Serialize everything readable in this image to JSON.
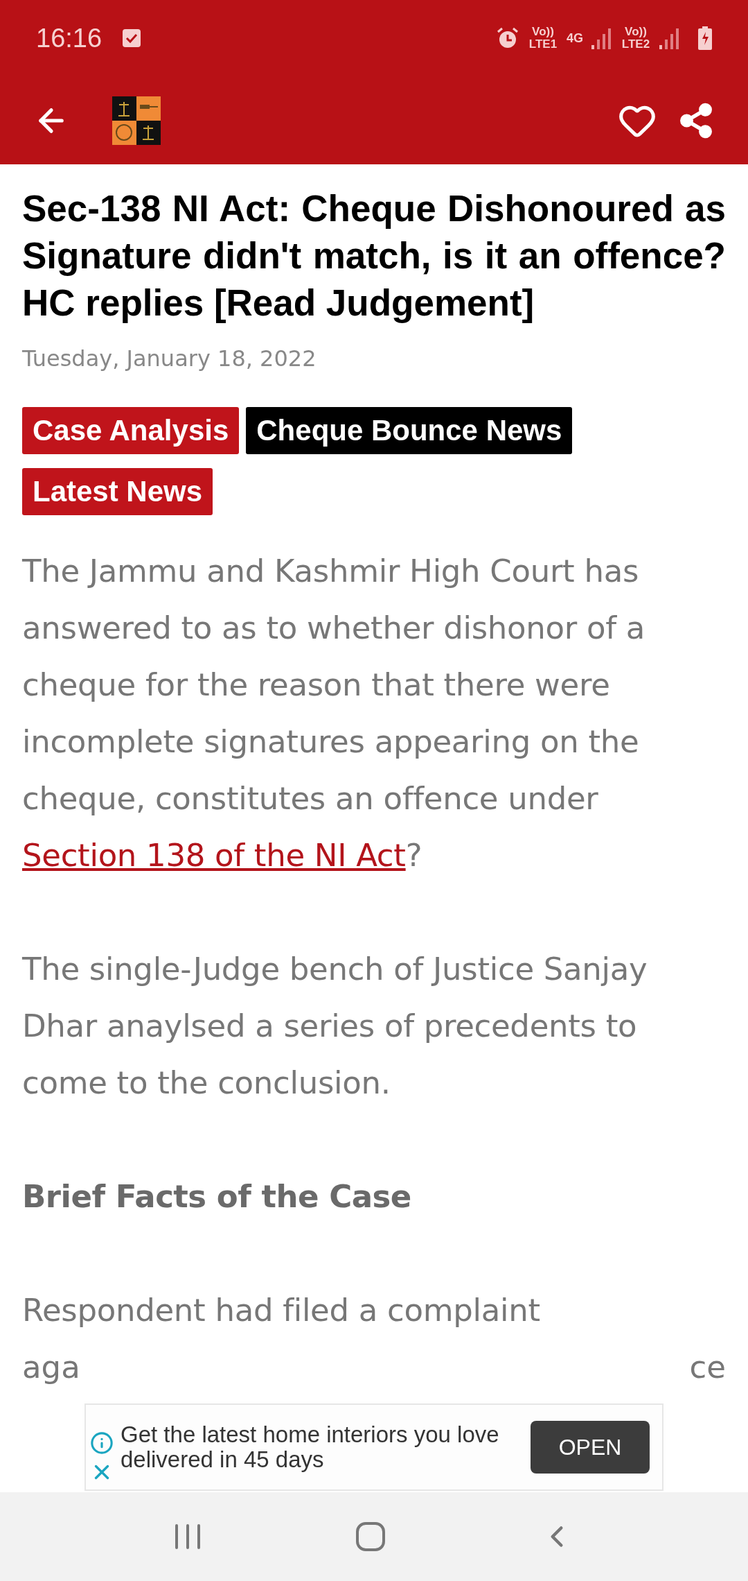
{
  "status_bar": {
    "time": "16:16",
    "sim1_label": "Vo)) LTE1",
    "network": "4G",
    "sim2_label": "Vo)) LTE2"
  },
  "article": {
    "title": "Sec-138 NI Act: Cheque Dishonoured as Signature didn't match, is it an offence? HC replies [Read Judgement]",
    "date": "Tuesday, January 18, 2022",
    "tags": [
      {
        "label": "Case Analysis",
        "color": "#c0141b"
      },
      {
        "label": "Cheque Bounce News",
        "color": "#000000"
      },
      {
        "label": "Latest News",
        "color": "#c0141b"
      }
    ],
    "paragraphs": [
      {
        "kind": "text",
        "text": "The Jammu and Kashmir High Court has answered to as to whether dishonor of a cheque for the reason that there were incomplete signatures appearing on the cheque, constitutes an offence under",
        "link": "Section 138 of the NI Act",
        "after": "?"
      },
      {
        "kind": "text",
        "text": "The single-Judge bench of Justice Sanjay Dhar anaylsed a series of precedents to come to the conclusion."
      },
      {
        "kind": "heading",
        "text": "Brief Facts of the Case"
      },
      {
        "kind": "partial",
        "line": "Respondent had filed a complaint",
        "left": "aga",
        "right": "ce"
      }
    ]
  },
  "ad": {
    "text": "Get the latest home interiors you love delivered in 45 days",
    "button": "OPEN"
  }
}
